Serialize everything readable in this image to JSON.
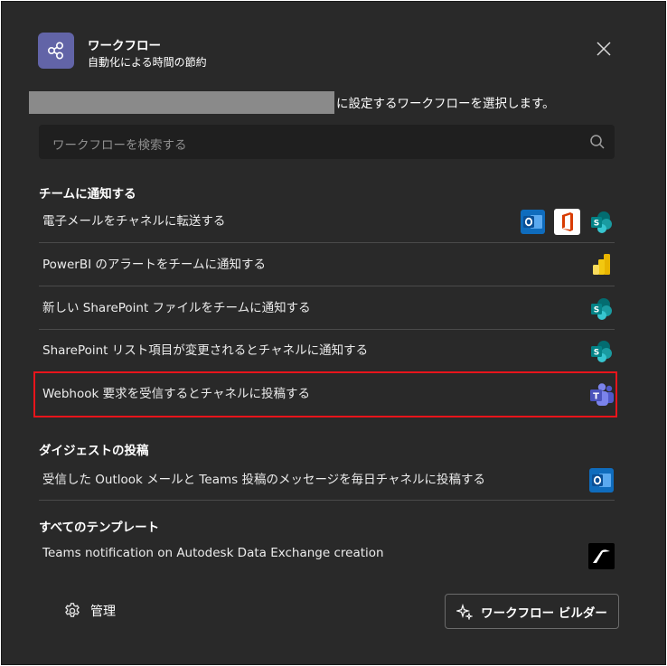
{
  "header": {
    "title": "ワークフロー",
    "subtitle": "自動化による時間の節約",
    "icon": "workflow-icon",
    "accent": "#6264a7"
  },
  "description": {
    "text": "に設定するワークフローを選択します。"
  },
  "search": {
    "placeholder": "ワークフローを検索する"
  },
  "sections": [
    {
      "title": "チームに通知する",
      "items": [
        {
          "label": "電子メールをチャネルに転送する",
          "icons": [
            "outlook-icon",
            "office-icon",
            "sharepoint-icon"
          ]
        },
        {
          "label": "PowerBI のアラートをチームに通知する",
          "icons": [
            "powerbi-icon"
          ]
        },
        {
          "label": "新しい SharePoint ファイルをチームに通知する",
          "icons": [
            "sharepoint-icon"
          ]
        },
        {
          "label": "SharePoint リスト項目が変更されるとチャネルに通知する",
          "icons": [
            "sharepoint-icon"
          ]
        },
        {
          "label": "Webhook 要求を受信するとチャネルに投稿する",
          "icons": [
            "teams-icon"
          ],
          "highlighted": true,
          "highlight_color": "#e8141b"
        }
      ]
    },
    {
      "title": "ダイジェストの投稿",
      "items": [
        {
          "label": "受信した Outlook メールと Teams 投稿のメッセージを毎日チャネルに投稿する",
          "icons": [
            "outlook-icon"
          ]
        }
      ]
    },
    {
      "title": "すべてのテンプレート",
      "items": [
        {
          "label": "Teams notification on Autodesk Data Exchange creation",
          "icons": [
            "autodesk-icon"
          ]
        }
      ]
    }
  ],
  "footer": {
    "manage_label": "管理",
    "builder_label": "ワークフロー ビルダー"
  }
}
